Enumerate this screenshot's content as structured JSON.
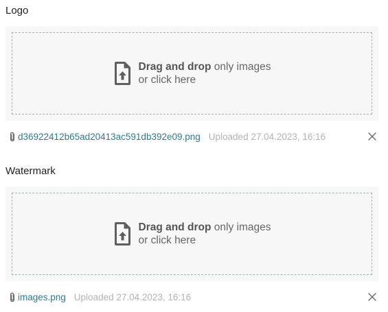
{
  "sections": [
    {
      "title": "Logo",
      "dropzone": {
        "bold": "Drag and drop",
        "rest": " only images",
        "line2": "or click here",
        "icon": "file-upload-icon"
      },
      "file": {
        "name": "d36922412b65ad20413ac591db392e09.png",
        "uploaded": "Uploaded 27.04.2023, 16:16",
        "attachment_icon": "paperclip-icon",
        "remove_icon": "close-icon"
      }
    },
    {
      "title": "Watermark",
      "dropzone": {
        "bold": "Drag and drop",
        "rest": " only images",
        "line2": "or click here",
        "icon": "file-upload-icon"
      },
      "file": {
        "name": "images.png",
        "uploaded": "Uploaded 27.04.2023, 16:16",
        "attachment_icon": "paperclip-icon",
        "remove_icon": "close-icon"
      }
    }
  ],
  "colors": {
    "link": "#2e7a8e",
    "muted": "#b3b3b3",
    "dropzone_bg": "#f7f7f7",
    "dashed_border": "#9fb3b3"
  }
}
